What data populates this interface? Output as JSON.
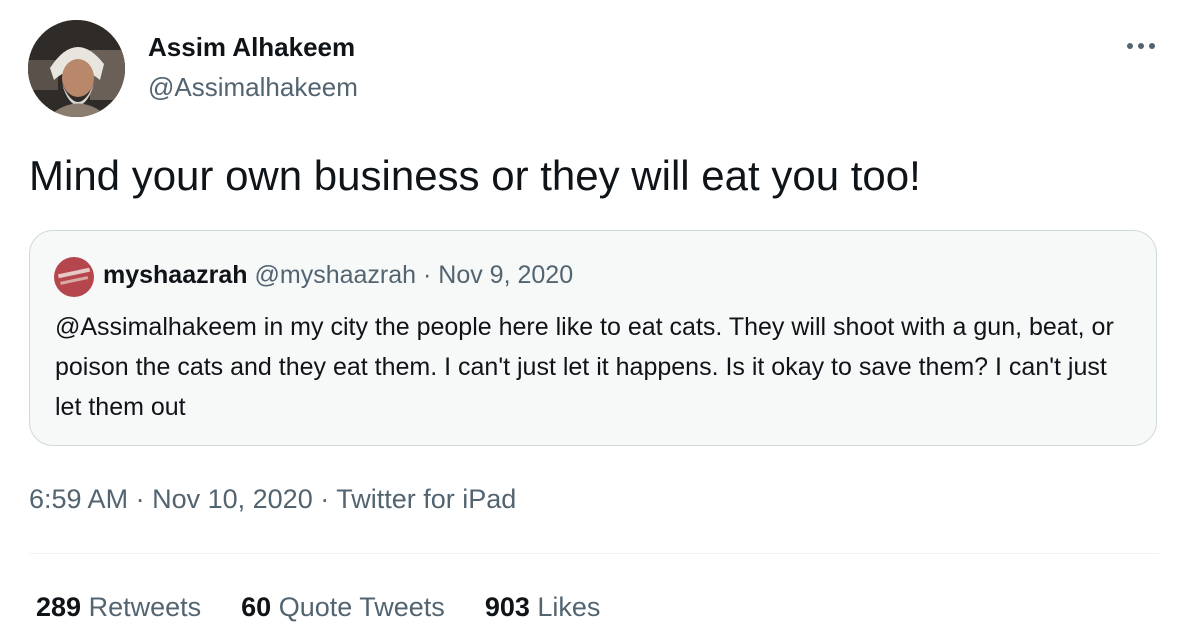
{
  "tweet": {
    "author": {
      "name": "Assim Alhakeem",
      "handle": "@Assimalhakeem",
      "avatar_icon": "user-avatar-photo"
    },
    "more_icon": "more-horizontal-icon",
    "text": "Mind your own business or they will eat you too!",
    "quoted_tweet": {
      "author_name": "myshaazrah",
      "author_handle": "@myshaazrah",
      "separator": "·",
      "date": "Nov 9, 2020",
      "avatar_icon": "quoted-user-avatar",
      "text": "@Assimalhakeem in my city the people here like to eat cats. They will shoot with a gun, beat, or poison the cats and they eat them. I can't just let it happens. Is it okay to save them? I can't just let them out"
    },
    "time": "6:59 AM",
    "date": "Nov 10, 2020",
    "source": "Twitter for iPad",
    "separator": "·",
    "stats": {
      "retweets": {
        "count": "289",
        "label": "Retweets"
      },
      "quote_tweets": {
        "count": "60",
        "label": "Quote Tweets"
      },
      "likes": {
        "count": "903",
        "label": "Likes"
      }
    }
  },
  "colors": {
    "text_primary": "#0f1419",
    "text_secondary": "#536471",
    "border": "#cfd9de",
    "quote_bg": "#f7f9f9"
  }
}
